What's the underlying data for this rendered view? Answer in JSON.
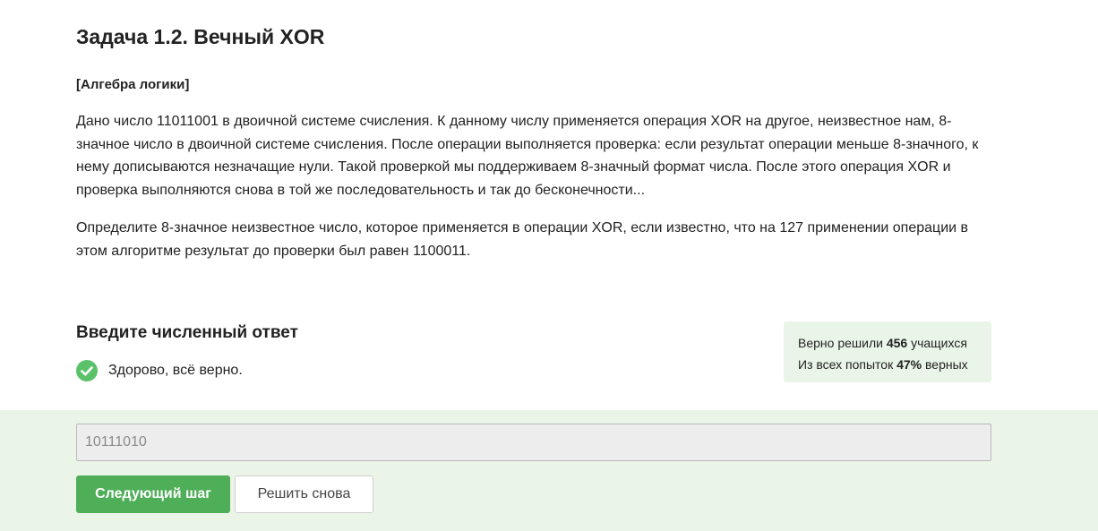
{
  "task": {
    "title": "Задача 1.2. Вечный XOR",
    "tag": "[Алгебра логики]",
    "paragraph_1": "Дано число 11011001 в двоичной системе счисления. К данному числу применяется операция XOR на другое, неизвестное нам, 8-значное число в двоичной системе счисления. После операции выполняется проверка: если результат операции меньше 8-значного, к нему дописываются незначащие нули. Такой проверкой мы поддерживаем 8-значный формат числа. После этого операция XOR и проверка выполняются снова в той же последовательность и так до бесконечности...",
    "paragraph_2": "Определите 8-значное неизвестное число, которое применяется в операции XOR, если известно, что на 127 применении операции в этом алгоритме результат до проверки был равен 1100011."
  },
  "answer": {
    "heading": "Введите численный ответ",
    "feedback": "Здорово, всё верно.",
    "feedback_icon": "check-circle-icon",
    "input_value": "10111010",
    "next_button_label": "Следующий шаг",
    "retry_button_label": "Решить снова"
  },
  "stats": {
    "solved_prefix": "Верно решили",
    "solved_count": "456",
    "solved_suffix": "учащихся",
    "attempts_prefix": "Из всех попыток",
    "attempts_percent": "47%",
    "attempts_suffix": "верных"
  },
  "colors": {
    "success_green": "#5cc26a",
    "button_green": "#4fae58",
    "answer_zone_bg": "#eaf5e8",
    "stats_bg": "#e9f5e8"
  }
}
